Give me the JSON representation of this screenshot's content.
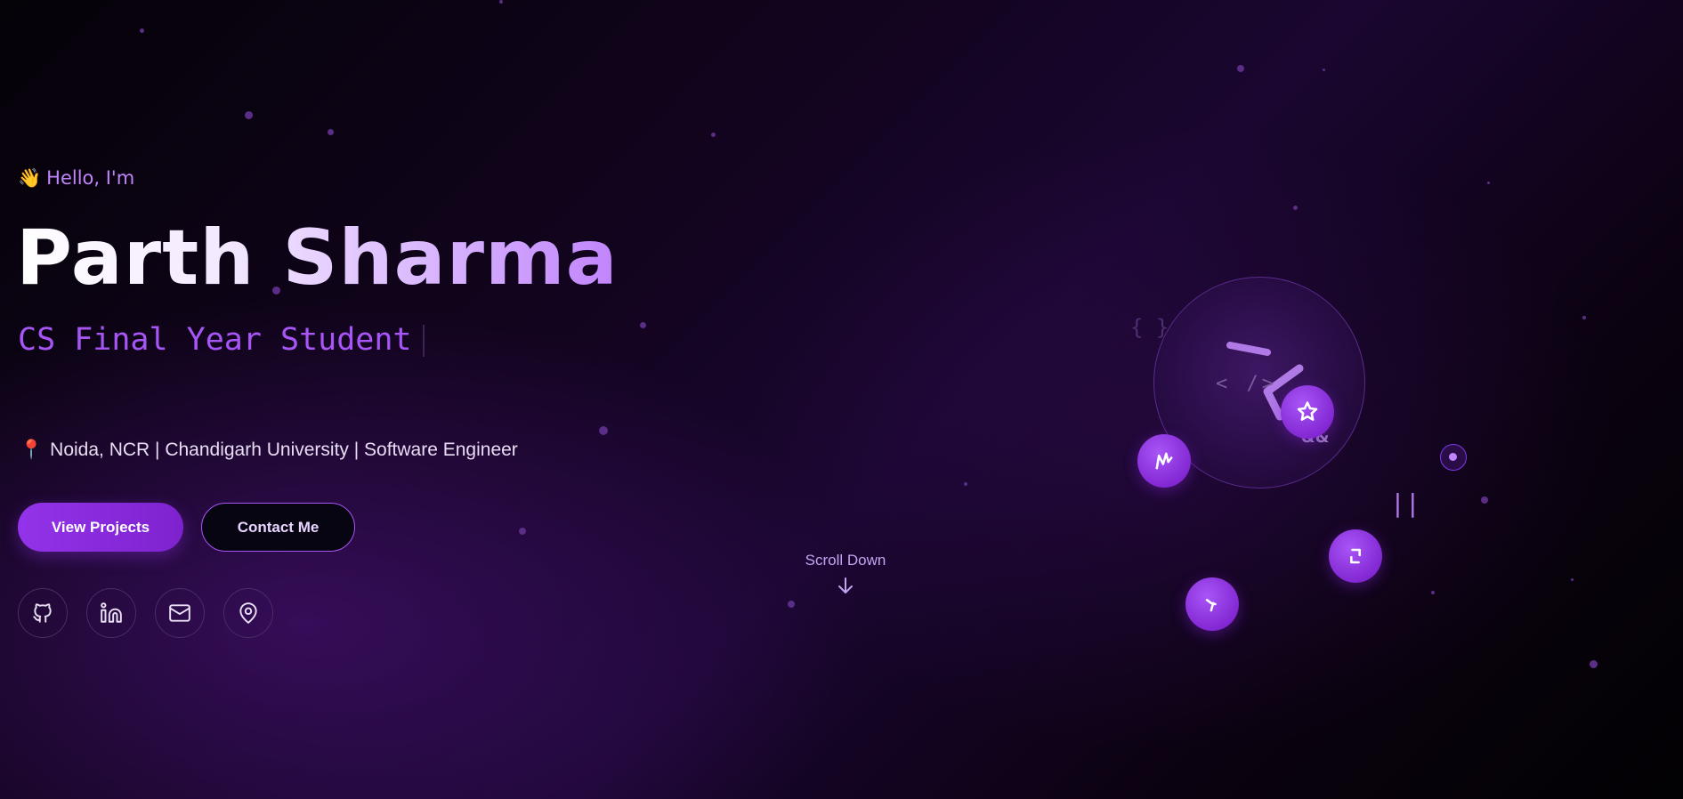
{
  "hero": {
    "greeting_emoji": "👋",
    "greeting": "Hello, I'm",
    "name": "Parth Sharma",
    "role": "CS Final Year Student",
    "location_emoji": "📍",
    "meta": "Noida, NCR | Chandigarh University | Software Engineer"
  },
  "buttons": {
    "primary": "View Projects",
    "secondary": "Contact Me"
  },
  "social": [
    {
      "icon": "github-icon"
    },
    {
      "icon": "linkedin-icon"
    },
    {
      "icon": "mail-icon"
    },
    {
      "icon": "map-pin-icon"
    }
  ],
  "scroll": {
    "label": "Scroll Down",
    "icon": "arrow-down-icon"
  },
  "decor": {
    "orb_code": "< />",
    "braces": "{ }",
    "ampersands": "&&",
    "pipes": "||"
  },
  "colors": {
    "accent": "#a855f7",
    "accent_dark": "#7e22ce",
    "background": "#12041e",
    "text": "#ffffff"
  }
}
